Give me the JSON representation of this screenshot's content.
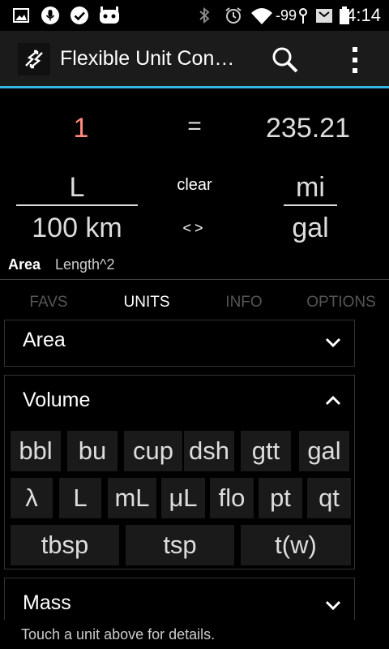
{
  "status_bar": {
    "signal_text": "-99",
    "time": "4:14",
    "icons": [
      "picture-icon",
      "mic-icon",
      "check-icon",
      "robot-icon",
      "bluetooth-icon",
      "alarm-icon",
      "wifi-icon",
      "signal-icon",
      "battery-icon"
    ]
  },
  "action_bar": {
    "title": "Flexible Unit Con…",
    "accent": "#33b5e5"
  },
  "converter": {
    "input_value": "1",
    "equals": "=",
    "output_value": "235.21",
    "from_unit_top": "L",
    "from_unit_bottom": "100  km",
    "to_unit_top": "mi",
    "to_unit_bottom": "gal",
    "clear_label": "clear",
    "swap_label": "<>",
    "dimension_label": "Area",
    "dimension_value": "Length^2"
  },
  "tabs": [
    {
      "label": "FAVS"
    },
    {
      "label": "UNITS"
    },
    {
      "label": "INFO"
    },
    {
      "label": "OPTIONS"
    }
  ],
  "categories": {
    "area": {
      "title": "Area"
    },
    "volume": {
      "title": "Volume",
      "units": [
        "bbl",
        "bu",
        "cup",
        "dsh",
        "gtt",
        "gal",
        "λ",
        "L",
        "mL",
        "μL",
        "flo",
        "pt",
        "qt",
        "tbsp",
        "tsp",
        "t(w)"
      ]
    },
    "mass": {
      "title": "Mass"
    }
  },
  "footer": {
    "hint": "Touch a unit above for details."
  }
}
